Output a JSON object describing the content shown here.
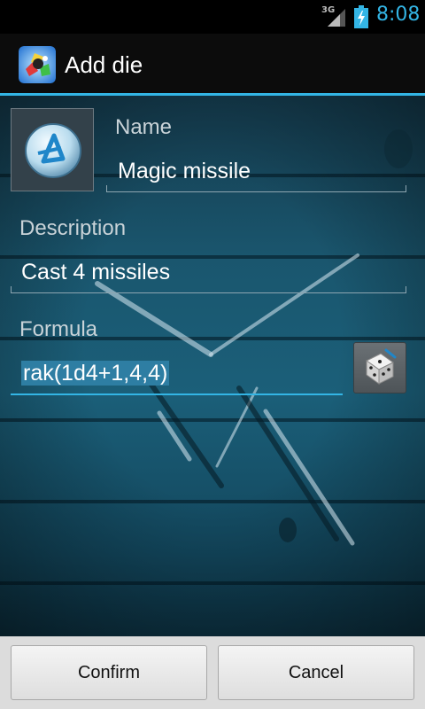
{
  "status_bar": {
    "network": "3G",
    "time": "8:08",
    "colors": {
      "clock": "#33b5e5"
    },
    "icons": [
      "signal-icon",
      "battery-charging-icon"
    ]
  },
  "action_bar": {
    "title": "Add die",
    "icon": "app-dice-icon",
    "accent_color": "#33b5e5"
  },
  "form": {
    "die_image_icon": "magic-missile-rune-icon",
    "name": {
      "label": "Name",
      "value": "Magic missile"
    },
    "description": {
      "label": "Description",
      "value": "Cast 4 missiles"
    },
    "formula": {
      "label": "Formula",
      "value": "rak(1d4+1,4,4)",
      "roll_button_icon": "dice-icon"
    }
  },
  "buttons": {
    "confirm": "Confirm",
    "cancel": "Cancel"
  }
}
